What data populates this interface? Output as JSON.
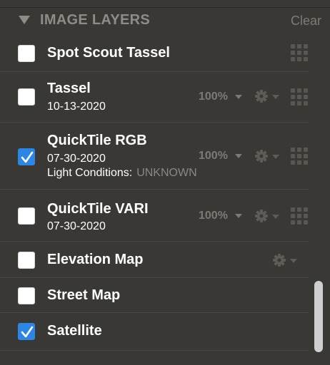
{
  "section": {
    "title": "IMAGE LAYERS",
    "clear_label": "Clear"
  },
  "layers": [
    {
      "title": "Spot Scout Tassel",
      "checked": false
    },
    {
      "title": "Tassel",
      "date": "10-13-2020",
      "opacity": "100%",
      "checked": false
    },
    {
      "title": "QuickTile RGB",
      "date": "07-30-2020",
      "opacity": "100%",
      "checked": true,
      "light_label": "Light Conditions:",
      "light_value": "UNKNOWN"
    },
    {
      "title": "QuickTile VARI",
      "date": "07-30-2020",
      "opacity": "100%",
      "checked": false
    },
    {
      "title": "Elevation Map",
      "checked": false
    },
    {
      "title": "Street Map",
      "checked": false
    },
    {
      "title": "Satellite",
      "checked": true
    }
  ],
  "colors": {
    "background": "#3a3835",
    "accent": "#2b86e6",
    "muted": "#7d7a76"
  }
}
